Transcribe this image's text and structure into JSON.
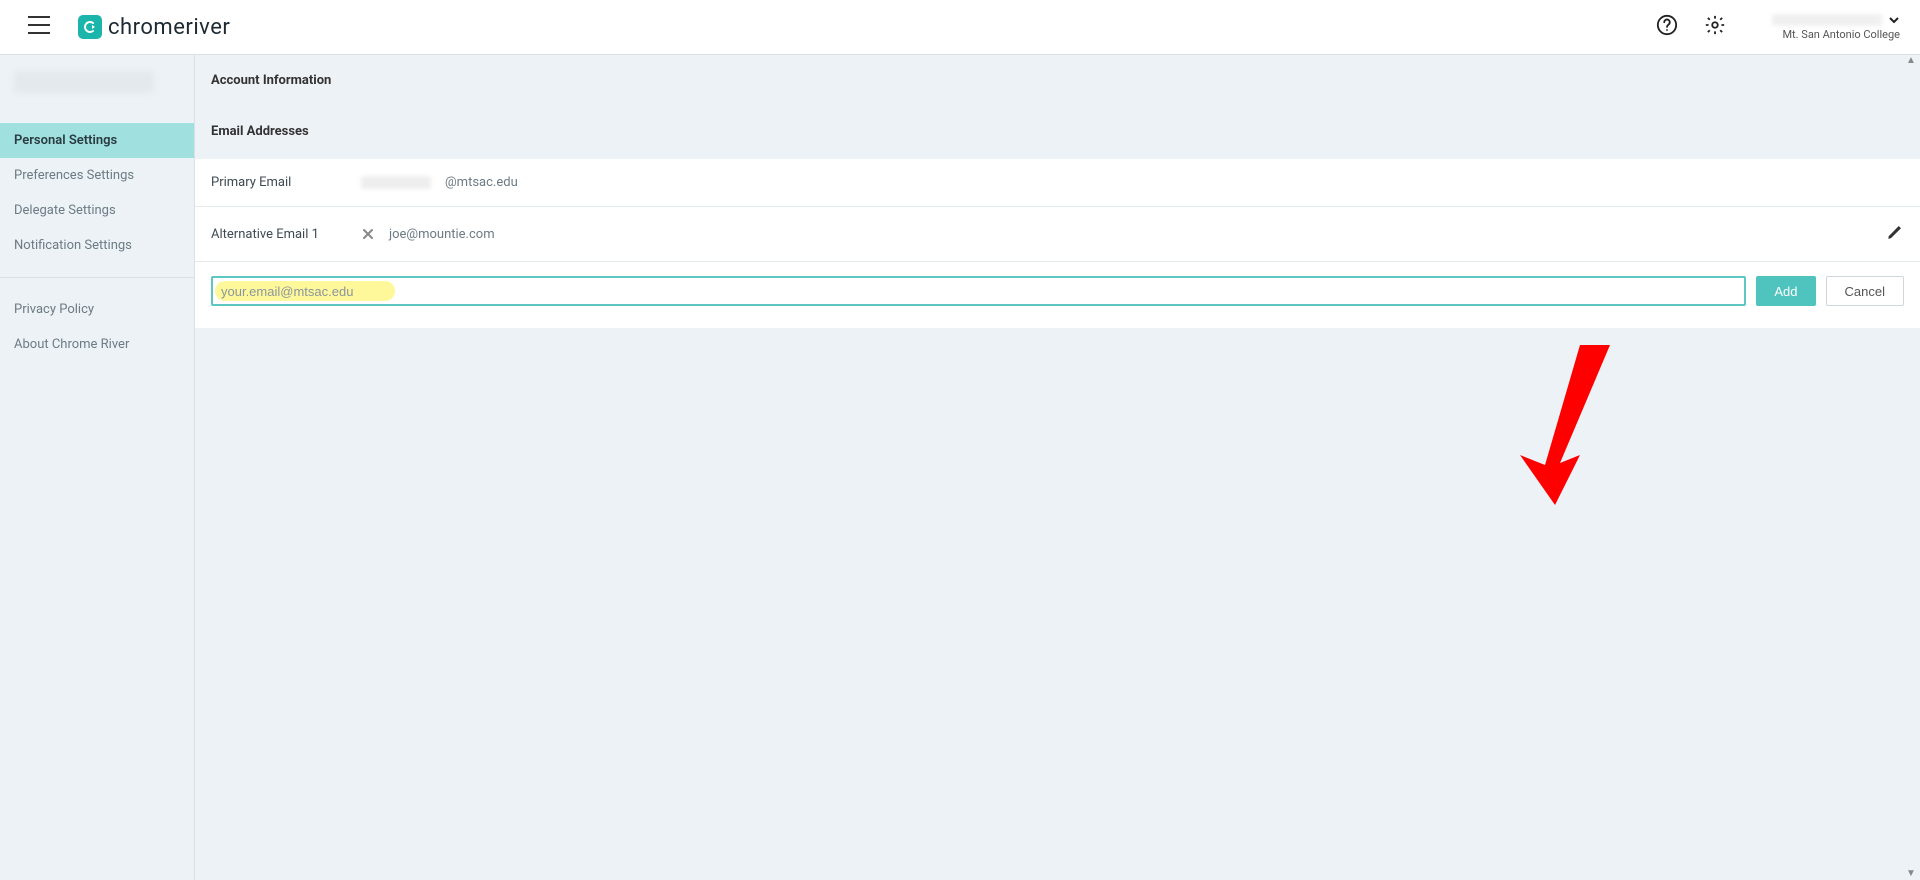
{
  "header": {
    "brand_name": "chromeriver",
    "logo_initials": "CR",
    "org_name": "Mt. San Antonio College"
  },
  "sidebar": {
    "items": [
      {
        "label": "Personal Settings",
        "active": true
      },
      {
        "label": "Preferences Settings",
        "active": false
      },
      {
        "label": "Delegate Settings",
        "active": false
      },
      {
        "label": "Notification Settings",
        "active": false
      }
    ],
    "footer_items": [
      {
        "label": "Privacy Policy"
      },
      {
        "label": "About Chrome River"
      }
    ]
  },
  "main": {
    "section_title": "Account Information",
    "sub_title": "Email Addresses",
    "primary_email": {
      "label": "Primary Email",
      "value_suffix": "@mtsac.edu"
    },
    "alt_email": {
      "label": "Alternative Email 1",
      "value": "joe@mountie.com"
    },
    "new_email_input": {
      "value": "your.email@mtsac.edu"
    },
    "add_btn": "Add",
    "cancel_btn": "Cancel"
  }
}
